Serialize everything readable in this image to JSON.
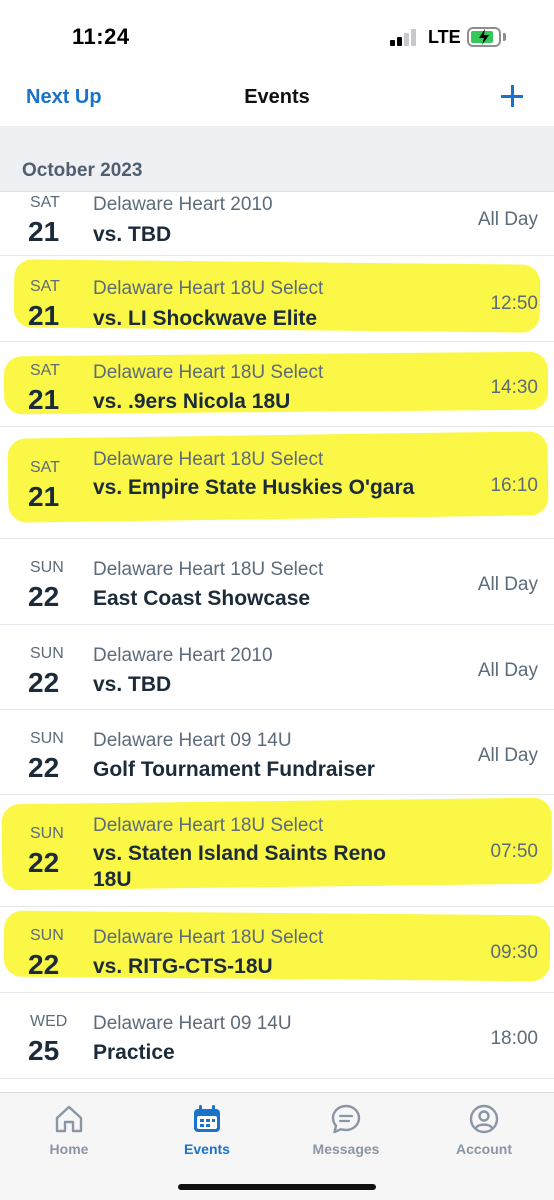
{
  "status": {
    "time": "11:24",
    "network": "LTE"
  },
  "nav": {
    "left_link": "Next Up",
    "title": "Events"
  },
  "month": "October 2023",
  "events": [
    {
      "day": "SAT",
      "date": "21",
      "team": "Delaware Heart 2010",
      "title": "vs. TBD",
      "time": "All Day",
      "highlighted": false
    },
    {
      "day": "SAT",
      "date": "21",
      "team": "Delaware Heart 18U Select",
      "title": "vs. LI Shockwave Elite",
      "time": "12:50",
      "highlighted": true
    },
    {
      "day": "SAT",
      "date": "21",
      "team": "Delaware Heart 18U Select",
      "title": "vs. .9ers Nicola 18U",
      "time": "14:30",
      "highlighted": true
    },
    {
      "day": "SAT",
      "date": "21",
      "team": "Delaware Heart 18U Select",
      "title": "vs. Empire State Huskies O'gara",
      "time": "16:10",
      "highlighted": true
    },
    {
      "day": "SUN",
      "date": "22",
      "team": "Delaware Heart 18U Select",
      "title": "East Coast Showcase",
      "time": "All Day",
      "highlighted": false
    },
    {
      "day": "SUN",
      "date": "22",
      "team": "Delaware Heart 2010",
      "title": "vs. TBD",
      "time": "All Day",
      "highlighted": false
    },
    {
      "day": "SUN",
      "date": "22",
      "team": "Delaware Heart 09 14U",
      "title": "Golf Tournament Fundraiser",
      "time": "All Day",
      "highlighted": false
    },
    {
      "day": "SUN",
      "date": "22",
      "team": "Delaware Heart 18U Select",
      "title": "vs. Staten Island Saints Reno 18U",
      "time": "07:50",
      "highlighted": true
    },
    {
      "day": "SUN",
      "date": "22",
      "team": "Delaware Heart 18U Select",
      "title": "vs. RITG-CTS-18U",
      "time": "09:30",
      "highlighted": true
    },
    {
      "day": "WED",
      "date": "25",
      "team": "Delaware Heart 09 14U",
      "title": "Practice",
      "time": "18:00",
      "highlighted": false
    }
  ],
  "tabs": [
    {
      "label": "Home",
      "icon": "home-icon",
      "active": false
    },
    {
      "label": "Events",
      "icon": "calendar-icon",
      "active": true
    },
    {
      "label": "Messages",
      "icon": "chat-icon",
      "active": false
    },
    {
      "label": "Account",
      "icon": "account-icon",
      "active": false
    }
  ],
  "colors": {
    "accent": "#1a73c8",
    "highlight": "#f8f31e",
    "battery": "#34c759"
  }
}
